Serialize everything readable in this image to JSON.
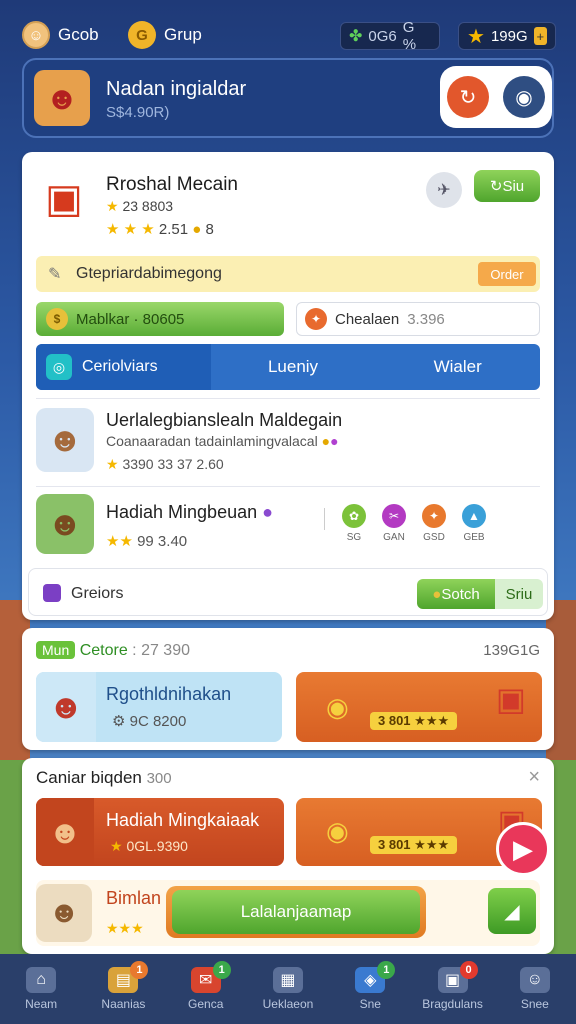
{
  "topbar": {
    "left_label": "Gcob",
    "group_label": "Grup",
    "currency_1": "0G6",
    "currency_1_tail": "G %",
    "currency_2": "199G"
  },
  "profile": {
    "name": "Nadan ingialdar",
    "sub": "S$4.90R)"
  },
  "panel": {
    "title": "Rroshal Mecain",
    "stars_line_1": "23 8803",
    "stars_line_2": "2.51",
    "stars_line_2_tail": "8",
    "action_label": "Siu"
  },
  "banner": {
    "text": "Gtepriardabimegong",
    "btn": "Order"
  },
  "stats": {
    "left_text": "Mablkar · 80605",
    "right_text": "Chealaen",
    "right_value": "3.396"
  },
  "tabs": [
    {
      "label": "Ceriolviars"
    },
    {
      "label": "Lueniy"
    },
    {
      "label": "Wialer"
    }
  ],
  "list": [
    {
      "title": "Uerlalegbianslealn Maldegain",
      "sub": "Coanaaradan tadainlamingvalacal",
      "stars": "3390 33 37 2.60"
    },
    {
      "title": "Hadiah Mingbeuan",
      "stars": "99 3.40",
      "mini": [
        "SG",
        "GAN",
        "GSD",
        "GEB"
      ]
    }
  ],
  "gretors": {
    "label": "Greiors",
    "btn_left": "Sotch",
    "btn_right": "Sriu"
  },
  "section2": {
    "tag": "Mun",
    "title": "Cetore",
    "value": "27 390",
    "right_value": "139G1G",
    "tile_title": "Rgothldnihakan",
    "tile_value": "9C 8200",
    "reward_label": "3 801"
  },
  "section3": {
    "title": "Caniar biqden",
    "value": "300",
    "card_title": "Hadiah Mingkaiaak",
    "card_value": "0GL.9390",
    "reward_label": "3 801",
    "last_title": "Bimlan",
    "cta": "Lalalanjaamap"
  },
  "nav": [
    {
      "label": "Neam",
      "icon": "home-icon"
    },
    {
      "label": "Naanias",
      "icon": "shop-icon",
      "badge": "1"
    },
    {
      "label": "Genca",
      "icon": "mail-icon",
      "badge": "1"
    },
    {
      "label": "Ueklaeon",
      "icon": "calendar-icon"
    },
    {
      "label": "Sne",
      "icon": "map-icon",
      "badge": "1"
    },
    {
      "label": "Bragdulans",
      "icon": "gift-icon",
      "badge": "0"
    },
    {
      "label": "Snee",
      "icon": "user-icon"
    }
  ]
}
